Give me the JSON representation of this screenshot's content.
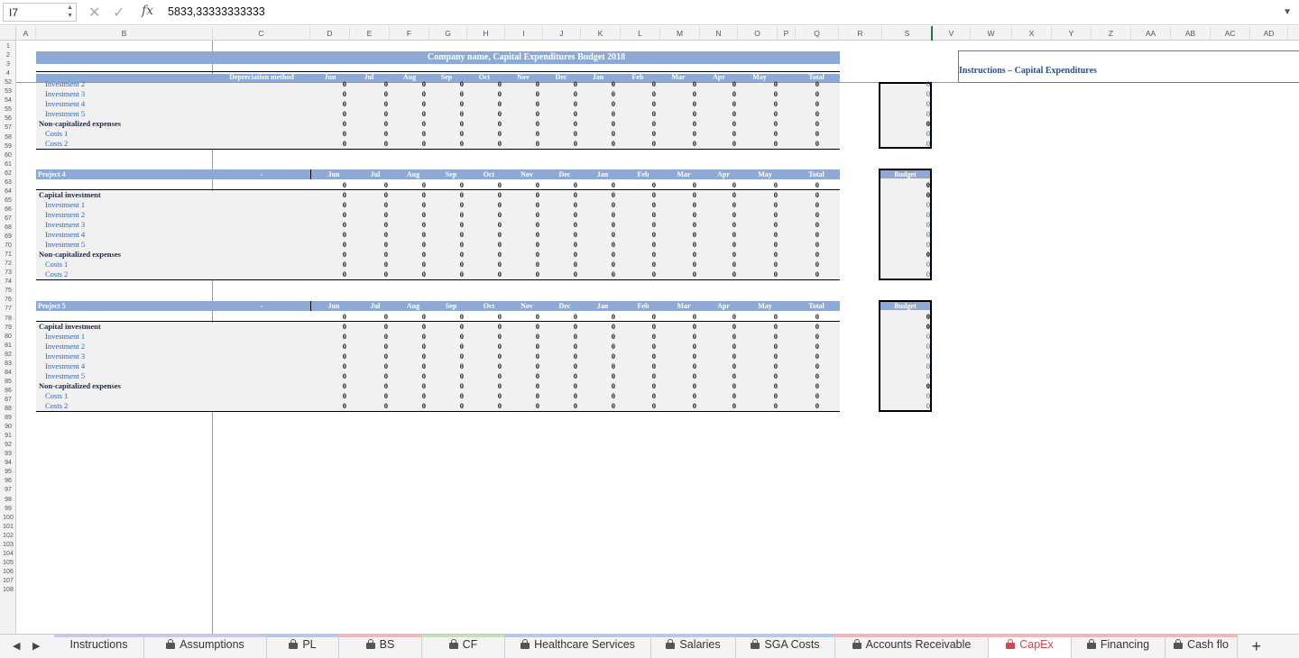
{
  "formula_bar": {
    "cell_ref": "I7",
    "formula": "5833,33333333333",
    "fx_label": "fx",
    "cancel_icon": "close-icon",
    "confirm_icon": "check-icon"
  },
  "columns": [
    "A",
    "B",
    "C",
    "D",
    "E",
    "F",
    "G",
    "H",
    "I",
    "J",
    "K",
    "L",
    "M",
    "N",
    "O",
    "P",
    "Q",
    "R",
    "S",
    "V",
    "W",
    "X",
    "Y",
    "Z",
    "AA",
    "AB",
    "AC",
    "AD"
  ],
  "rows_top": [
    "1",
    "2",
    "3",
    "4"
  ],
  "rows_scrolled_start": 52,
  "rows_scrolled_end": 108,
  "sheet": {
    "title": "Company name, Capital Expenditures Budget 2018",
    "header_row": {
      "depreciation": "Depreciation method",
      "months": [
        "Jun",
        "Jul",
        "Aug",
        "Sep",
        "Oct",
        "Nov",
        "Dec",
        "Jan",
        "Feb",
        "Mar",
        "Apr",
        "May"
      ],
      "total": "Total"
    },
    "top_block": {
      "rows": [
        {
          "label": "Investment 2",
          "style": "blue"
        },
        {
          "label": "Investment 3",
          "style": "blue"
        },
        {
          "label": "Investment 4",
          "style": "blue"
        },
        {
          "label": "Investment 5",
          "style": "blue"
        },
        {
          "label": "Non-capitalized expenses",
          "style": "bold"
        },
        {
          "label": "Costs 1",
          "style": "blue"
        },
        {
          "label": "Costs 2",
          "style": "blue"
        }
      ]
    },
    "projects": [
      {
        "name": "Project 4",
        "method": "-",
        "budget_label": "Budget",
        "rows": [
          {
            "label": "",
            "style": "blank"
          },
          {
            "label": "Capital investment",
            "style": "bold"
          },
          {
            "label": "Investment 1",
            "style": "blue"
          },
          {
            "label": "Investment 2",
            "style": "blue"
          },
          {
            "label": "Investment 3",
            "style": "blue"
          },
          {
            "label": "Investment 4",
            "style": "blue"
          },
          {
            "label": "Investment 5",
            "style": "blue"
          },
          {
            "label": "Non-capitalized expenses",
            "style": "bold"
          },
          {
            "label": "Costs 1",
            "style": "blue"
          },
          {
            "label": "Costs 2",
            "style": "blue"
          }
        ]
      },
      {
        "name": "Project 5",
        "method": "-",
        "budget_label": "Budget",
        "rows": [
          {
            "label": "",
            "style": "blank"
          },
          {
            "label": "Capital investment",
            "style": "bold"
          },
          {
            "label": "Investment 1",
            "style": "blue"
          },
          {
            "label": "Investment 2",
            "style": "blue"
          },
          {
            "label": "Investment 3",
            "style": "blue"
          },
          {
            "label": "Investment 4",
            "style": "blue"
          },
          {
            "label": "Investment 5",
            "style": "blue"
          },
          {
            "label": "Non-capitalized expenses",
            "style": "bold"
          },
          {
            "label": "Costs 1",
            "style": "blue"
          },
          {
            "label": "Costs 2",
            "style": "blue"
          }
        ]
      }
    ],
    "cell_value": "0",
    "instructions_title": "Instructions – Capital Expenditures"
  },
  "tabs": [
    {
      "label": "Instructions",
      "locked": false,
      "color": "#c8c8e8",
      "active": false
    },
    {
      "label": "Assumptions",
      "locked": true,
      "color": "#c8c8e8",
      "active": false
    },
    {
      "label": "PL",
      "locked": true,
      "color": "#b8c8e8",
      "active": false
    },
    {
      "label": "BS",
      "locked": true,
      "color": "#f0b8b8",
      "active": false
    },
    {
      "label": "CF",
      "locked": true,
      "color": "#c8e0b8",
      "active": false
    },
    {
      "label": "Healthcare Services",
      "locked": true,
      "color": "#b8c8e8",
      "active": false
    },
    {
      "label": "Salaries",
      "locked": true,
      "color": "#b8c8e8",
      "active": false
    },
    {
      "label": "SGA Costs",
      "locked": true,
      "color": "#b8c8e8",
      "active": false
    },
    {
      "label": "Accounts Receivable",
      "locked": true,
      "color": "#f0b8b8",
      "active": false
    },
    {
      "label": "CapEx",
      "locked": true,
      "color": "#f0b8b8",
      "active": true
    },
    {
      "label": "Financing",
      "locked": true,
      "color": "#f0b8b8",
      "active": false
    },
    {
      "label": "Cash flo",
      "locked": true,
      "color": "#f0b8b8",
      "active": false
    }
  ],
  "add_sheet_label": "+"
}
